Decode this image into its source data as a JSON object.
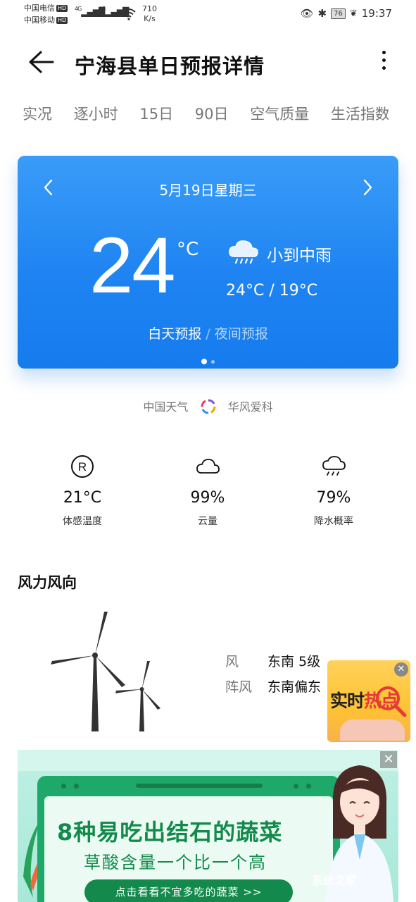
{
  "status_bar": {
    "carrier1": "中国电信",
    "carrier2": "中国移动",
    "hd": "HD",
    "net_speed_value": "710",
    "net_speed_unit": "K/s",
    "signal1": "4G",
    "signal2": "4G",
    "battery": "76",
    "time": "19:37"
  },
  "appbar": {
    "title": "宁海县单日预报详情"
  },
  "tabs": [
    "实况",
    "逐小时",
    "15日",
    "90日",
    "空气质量",
    "生活指数"
  ],
  "card": {
    "date": "5月19日星期三",
    "temperature": "24",
    "temp_unit": "°C",
    "weather": "小到中雨",
    "range": "24°C / 19°C",
    "day_label": "白天预报",
    "separator": "/",
    "night_label": "夜间预报"
  },
  "source": {
    "left": "中国天气",
    "right": "华风爱科"
  },
  "metrics": [
    {
      "value": "21°C",
      "label": "体感温度",
      "icon": "real-feel-icon"
    },
    {
      "value": "99%",
      "label": "云量",
      "icon": "cloud-icon"
    },
    {
      "value": "79%",
      "label": "降水概率",
      "icon": "rain-cloud-icon"
    }
  ],
  "wind": {
    "title": "风力风向",
    "wind_label": "风",
    "wind_value": "东南 5级",
    "gust_label": "阵风",
    "gust_value": "东南偏东"
  },
  "hot_badge": {
    "text_a": "实时",
    "text_b": "热点"
  },
  "ad": {
    "headline": "8种易吃出结石的蔬菜",
    "subheadline": "草酸含量一个比一个高",
    "cta": "点击看看不宜多吃的蔬菜 >>",
    "watermark": "系统之家"
  },
  "colors": {
    "card_blue": "#1f84f2",
    "ad_green": "#138a4c",
    "hot_yellow": "#ffc233"
  }
}
